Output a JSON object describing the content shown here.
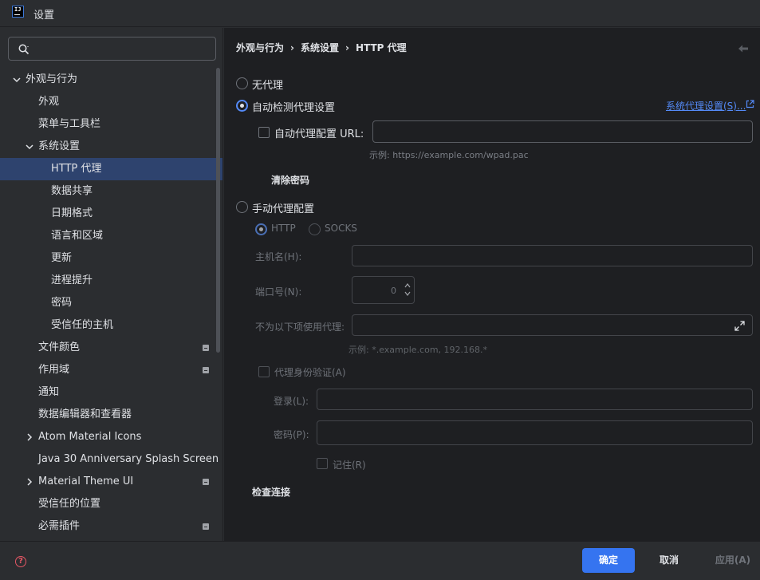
{
  "window": {
    "title": "设置"
  },
  "search": {
    "placeholder": "",
    "value": ""
  },
  "tree": [
    {
      "label": "外观与行为",
      "level": 0,
      "expanded": true
    },
    {
      "label": "外观",
      "level": 1
    },
    {
      "label": "菜单与工具栏",
      "level": 1
    },
    {
      "label": "系统设置",
      "level": 1,
      "expanded": true
    },
    {
      "label": "HTTP 代理",
      "level": 2,
      "selected": true
    },
    {
      "label": "数据共享",
      "level": 2
    },
    {
      "label": "日期格式",
      "level": 2
    },
    {
      "label": "语言和区域",
      "level": 2
    },
    {
      "label": "更新",
      "level": 2
    },
    {
      "label": "进程提升",
      "level": 2
    },
    {
      "label": "密码",
      "level": 2
    },
    {
      "label": "受信任的主机",
      "level": 2
    },
    {
      "label": "文件颜色",
      "level": 1,
      "badge": true
    },
    {
      "label": "作用域",
      "level": 1,
      "badge": true
    },
    {
      "label": "通知",
      "level": 1
    },
    {
      "label": "数据编辑器和查看器",
      "level": 1
    },
    {
      "label": "Atom Material Icons",
      "level": 1,
      "collapsed": true
    },
    {
      "label": "Java 30 Anniversary Splash Screen",
      "level": 1
    },
    {
      "label": "Material Theme UI",
      "level": 1,
      "collapsed": true,
      "badge": true
    },
    {
      "label": "受信任的位置",
      "level": 1
    },
    {
      "label": "必需插件",
      "level": 1,
      "badge": true
    }
  ],
  "breadcrumb": {
    "part1": "外观与行为",
    "separator": "›",
    "part2": "系统设置",
    "part3": "HTTP 代理"
  },
  "proxy": {
    "no_proxy": "无代理",
    "auto_detect": "自动检测代理设置",
    "system_proxy_link": "系统代理设置(S)...",
    "auto_config_url_label": "自动代理配置 URL:",
    "auto_config_url_value": "",
    "auto_config_hint": "示例: https://example.com/wpad.pac",
    "clear_passwords": "清除密码",
    "manual": "手动代理配置",
    "http": "HTTP",
    "socks": "SOCKS",
    "host_label": "主机名(H):",
    "host_value": "",
    "port_label": "端口号(N):",
    "port_value": "0",
    "no_proxy_for_label": "不为以下项使用代理:",
    "no_proxy_for_value": "",
    "no_proxy_hint": "示例: *.example.com, 192.168.*",
    "auth_label": "代理身份验证(A)",
    "login_label": "登录(L):",
    "login_value": "",
    "password_label": "密码(P):",
    "password_value": "",
    "remember_label": "记住(R)",
    "check_connection": "检查连接",
    "selected_mode": "auto_detect",
    "manual_type": "HTTP"
  },
  "footer": {
    "ok": "确定",
    "cancel": "取消",
    "apply": "应用(A)"
  },
  "colors": {
    "accent": "#3574f0",
    "selection": "#2e436e",
    "link": "#548af7",
    "help": "#e55765"
  }
}
